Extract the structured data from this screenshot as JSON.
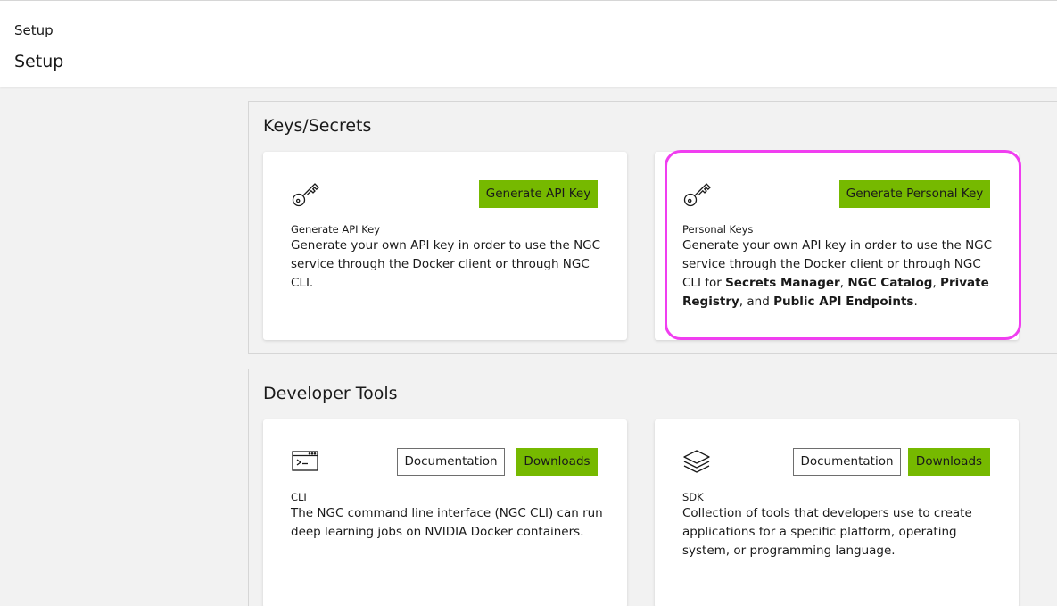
{
  "header": {
    "breadcrumb": "Setup",
    "title": "Setup"
  },
  "keys_section": {
    "title": "Keys/Secrets",
    "cards": [
      {
        "icon": "key-icon",
        "button_label": "Generate API Key",
        "label": "Generate API Key",
        "description": "Generate your own API key in order to use the NGC service through the Docker client or through NGC CLI."
      },
      {
        "icon": "key-icon",
        "button_label": "Generate Personal Key",
        "label": "Personal Keys",
        "description_parts": {
          "intro": "Generate your own API key in order to use the NGC service through the Docker client or through NGC CLI for ",
          "item1": "Secrets Manager",
          "sep1": ", ",
          "item2": "NGC Catalog",
          "sep2": ", ",
          "item3": "Private Registry",
          "sep3": ", and ",
          "item4": "Public API Endpoints",
          "end": "."
        }
      }
    ]
  },
  "tools_section": {
    "title": "Developer Tools",
    "cards": [
      {
        "icon": "terminal-icon",
        "doc_label": "Documentation",
        "download_label": "Downloads",
        "label": "CLI",
        "description": "The NGC command line interface (NGC CLI) can run deep learning jobs on NVIDIA Docker containers."
      },
      {
        "icon": "layers-icon",
        "doc_label": "Documentation",
        "download_label": "Downloads",
        "label": "SDK",
        "description": "Collection of tools that developers use to create applications for a specific platform, operating system, or programming language."
      }
    ]
  },
  "colors": {
    "accent_green": "#76b900",
    "highlight_magenta": "#f03ef0",
    "background": "#f2f2f2"
  }
}
